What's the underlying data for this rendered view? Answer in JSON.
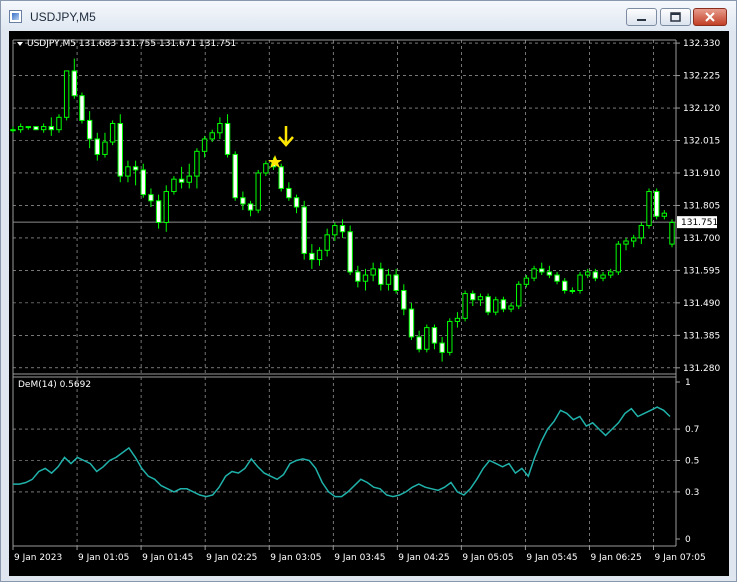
{
  "window": {
    "title": "USDJPY,M5"
  },
  "symbol_info": "USDJPY,M5  131.683 131.755 131.671 131.751",
  "current_price": "131.751",
  "indicator_label": "DeM(14) 0.5692",
  "colors": {
    "background": "#000000",
    "grid": "#c0c0c0",
    "bull": "#00ff00",
    "bear": "#ffffff",
    "indicator": "#20b2aa",
    "marker": "#ffe600"
  },
  "chart_data": {
    "type": "candlestick",
    "symbol": "USDJPY",
    "timeframe": "M5",
    "price_axis": [
      "132.330",
      "132.225",
      "132.120",
      "132.015",
      "131.910",
      "131.805",
      "131.700",
      "131.595",
      "131.490",
      "131.385",
      "131.280"
    ],
    "price_range": [
      131.26,
      132.34
    ],
    "time_axis": [
      "9 Jan 2023",
      "9 Jan 01:05",
      "9 Jan 01:45",
      "9 Jan 02:25",
      "9 Jan 03:05",
      "9 Jan 03:45",
      "9 Jan 04:25",
      "9 Jan 05:05",
      "9 Jan 05:45",
      "9 Jan 06:25",
      "9 Jan 07:05"
    ],
    "candles": [
      {
        "o": 132.05,
        "h": 132.06,
        "l": 132.04,
        "c": 132.05
      },
      {
        "o": 132.05,
        "h": 132.07,
        "l": 132.04,
        "c": 132.06
      },
      {
        "o": 132.06,
        "h": 132.06,
        "l": 132.05,
        "c": 132.06
      },
      {
        "o": 132.06,
        "h": 132.06,
        "l": 132.05,
        "c": 132.05
      },
      {
        "o": 132.05,
        "h": 132.07,
        "l": 132.04,
        "c": 132.06
      },
      {
        "o": 132.06,
        "h": 132.09,
        "l": 132.03,
        "c": 132.05
      },
      {
        "o": 132.05,
        "h": 132.1,
        "l": 132.04,
        "c": 132.09
      },
      {
        "o": 132.09,
        "h": 132.24,
        "l": 132.08,
        "c": 132.24
      },
      {
        "o": 132.24,
        "h": 132.28,
        "l": 132.15,
        "c": 132.16
      },
      {
        "o": 132.16,
        "h": 132.17,
        "l": 132.07,
        "c": 132.08
      },
      {
        "o": 132.08,
        "h": 132.11,
        "l": 131.99,
        "c": 132.02
      },
      {
        "o": 132.02,
        "h": 132.04,
        "l": 131.95,
        "c": 131.97
      },
      {
        "o": 131.97,
        "h": 132.04,
        "l": 131.96,
        "c": 132.01
      },
      {
        "o": 132.01,
        "h": 132.08,
        "l": 132.0,
        "c": 132.07
      },
      {
        "o": 132.07,
        "h": 132.1,
        "l": 131.88,
        "c": 131.9
      },
      {
        "o": 131.9,
        "h": 131.95,
        "l": 131.88,
        "c": 131.93
      },
      {
        "o": 131.93,
        "h": 131.95,
        "l": 131.87,
        "c": 131.92
      },
      {
        "o": 131.92,
        "h": 131.94,
        "l": 131.83,
        "c": 131.84
      },
      {
        "o": 131.84,
        "h": 131.86,
        "l": 131.8,
        "c": 131.82
      },
      {
        "o": 131.82,
        "h": 131.84,
        "l": 131.73,
        "c": 131.75
      },
      {
        "o": 131.75,
        "h": 131.87,
        "l": 131.72,
        "c": 131.85
      },
      {
        "o": 131.85,
        "h": 131.9,
        "l": 131.84,
        "c": 131.89
      },
      {
        "o": 131.89,
        "h": 131.93,
        "l": 131.86,
        "c": 131.88
      },
      {
        "o": 131.88,
        "h": 131.94,
        "l": 131.86,
        "c": 131.9
      },
      {
        "o": 131.9,
        "h": 131.99,
        "l": 131.86,
        "c": 131.98
      },
      {
        "o": 131.98,
        "h": 132.03,
        "l": 131.96,
        "c": 132.02
      },
      {
        "o": 132.02,
        "h": 132.05,
        "l": 132.01,
        "c": 132.04
      },
      {
        "o": 132.04,
        "h": 132.09,
        "l": 132.02,
        "c": 132.07
      },
      {
        "o": 132.07,
        "h": 132.1,
        "l": 131.96,
        "c": 131.97
      },
      {
        "o": 131.97,
        "h": 131.98,
        "l": 131.82,
        "c": 131.83
      },
      {
        "o": 131.83,
        "h": 131.85,
        "l": 131.79,
        "c": 131.81
      },
      {
        "o": 131.81,
        "h": 131.82,
        "l": 131.77,
        "c": 131.79
      },
      {
        "o": 131.79,
        "h": 131.92,
        "l": 131.78,
        "c": 131.91
      },
      {
        "o": 131.91,
        "h": 131.95,
        "l": 131.9,
        "c": 131.94
      },
      {
        "o": 131.94,
        "h": 131.96,
        "l": 131.92,
        "c": 131.93
      },
      {
        "o": 131.93,
        "h": 131.94,
        "l": 131.85,
        "c": 131.86
      },
      {
        "o": 131.86,
        "h": 131.88,
        "l": 131.82,
        "c": 131.83
      },
      {
        "o": 131.83,
        "h": 131.84,
        "l": 131.78,
        "c": 131.8
      },
      {
        "o": 131.8,
        "h": 131.82,
        "l": 131.63,
        "c": 131.65
      },
      {
        "o": 131.65,
        "h": 131.68,
        "l": 131.6,
        "c": 131.63
      },
      {
        "o": 131.63,
        "h": 131.67,
        "l": 131.61,
        "c": 131.66
      },
      {
        "o": 131.66,
        "h": 131.73,
        "l": 131.64,
        "c": 131.71
      },
      {
        "o": 131.71,
        "h": 131.75,
        "l": 131.69,
        "c": 131.74
      },
      {
        "o": 131.74,
        "h": 131.76,
        "l": 131.7,
        "c": 131.72
      },
      {
        "o": 131.72,
        "h": 131.74,
        "l": 131.58,
        "c": 131.59
      },
      {
        "o": 131.59,
        "h": 131.61,
        "l": 131.54,
        "c": 131.56
      },
      {
        "o": 131.56,
        "h": 131.6,
        "l": 131.53,
        "c": 131.58
      },
      {
        "o": 131.58,
        "h": 131.62,
        "l": 131.56,
        "c": 131.6
      },
      {
        "o": 131.6,
        "h": 131.62,
        "l": 131.53,
        "c": 131.55
      },
      {
        "o": 131.55,
        "h": 131.6,
        "l": 131.53,
        "c": 131.58
      },
      {
        "o": 131.58,
        "h": 131.6,
        "l": 131.52,
        "c": 131.53
      },
      {
        "o": 131.53,
        "h": 131.55,
        "l": 131.45,
        "c": 131.47
      },
      {
        "o": 131.47,
        "h": 131.49,
        "l": 131.37,
        "c": 131.38
      },
      {
        "o": 131.38,
        "h": 131.4,
        "l": 131.33,
        "c": 131.34
      },
      {
        "o": 131.34,
        "h": 131.42,
        "l": 131.33,
        "c": 131.41
      },
      {
        "o": 131.41,
        "h": 131.42,
        "l": 131.34,
        "c": 131.36
      },
      {
        "o": 131.36,
        "h": 131.38,
        "l": 131.3,
        "c": 131.33
      },
      {
        "o": 131.33,
        "h": 131.44,
        "l": 131.32,
        "c": 131.43
      },
      {
        "o": 131.43,
        "h": 131.46,
        "l": 131.41,
        "c": 131.44
      },
      {
        "o": 131.44,
        "h": 131.53,
        "l": 131.43,
        "c": 131.52
      },
      {
        "o": 131.52,
        "h": 131.53,
        "l": 131.48,
        "c": 131.5
      },
      {
        "o": 131.5,
        "h": 131.52,
        "l": 131.48,
        "c": 131.51
      },
      {
        "o": 131.51,
        "h": 131.52,
        "l": 131.45,
        "c": 131.46
      },
      {
        "o": 131.46,
        "h": 131.51,
        "l": 131.45,
        "c": 131.5
      },
      {
        "o": 131.5,
        "h": 131.51,
        "l": 131.46,
        "c": 131.47
      },
      {
        "o": 131.47,
        "h": 131.49,
        "l": 131.46,
        "c": 131.48
      },
      {
        "o": 131.48,
        "h": 131.56,
        "l": 131.47,
        "c": 131.55
      },
      {
        "o": 131.55,
        "h": 131.58,
        "l": 131.54,
        "c": 131.57
      },
      {
        "o": 131.57,
        "h": 131.61,
        "l": 131.56,
        "c": 131.6
      },
      {
        "o": 131.6,
        "h": 131.62,
        "l": 131.58,
        "c": 131.59
      },
      {
        "o": 131.59,
        "h": 131.61,
        "l": 131.57,
        "c": 131.58
      },
      {
        "o": 131.58,
        "h": 131.59,
        "l": 131.55,
        "c": 131.56
      },
      {
        "o": 131.56,
        "h": 131.57,
        "l": 131.52,
        "c": 131.53
      },
      {
        "o": 131.53,
        "h": 131.54,
        "l": 131.52,
        "c": 131.53
      },
      {
        "o": 131.53,
        "h": 131.59,
        "l": 131.52,
        "c": 131.58
      },
      {
        "o": 131.58,
        "h": 131.6,
        "l": 131.57,
        "c": 131.59
      },
      {
        "o": 131.59,
        "h": 131.6,
        "l": 131.56,
        "c": 131.57
      },
      {
        "o": 131.57,
        "h": 131.59,
        "l": 131.56,
        "c": 131.58
      },
      {
        "o": 131.58,
        "h": 131.6,
        "l": 131.57,
        "c": 131.59
      },
      {
        "o": 131.59,
        "h": 131.69,
        "l": 131.58,
        "c": 131.68
      },
      {
        "o": 131.68,
        "h": 131.7,
        "l": 131.66,
        "c": 131.69
      },
      {
        "o": 131.69,
        "h": 131.71,
        "l": 131.67,
        "c": 131.7
      },
      {
        "o": 131.7,
        "h": 131.75,
        "l": 131.68,
        "c": 131.74
      },
      {
        "o": 131.74,
        "h": 131.86,
        "l": 131.73,
        "c": 131.85
      },
      {
        "o": 131.85,
        "h": 131.86,
        "l": 131.76,
        "c": 131.77
      },
      {
        "o": 131.77,
        "h": 131.79,
        "l": 131.76,
        "c": 131.78
      },
      {
        "o": 131.68,
        "h": 131.76,
        "l": 131.67,
        "c": 131.75
      }
    ],
    "indicator": {
      "name": "DeM(14)",
      "value": 0.5692,
      "axis_labels": [
        "1",
        "0.7",
        "0.5",
        "0.3",
        "0"
      ],
      "range": [
        0,
        1
      ],
      "values": [
        0.35,
        0.35,
        0.36,
        0.38,
        0.43,
        0.45,
        0.42,
        0.46,
        0.52,
        0.48,
        0.52,
        0.5,
        0.48,
        0.43,
        0.46,
        0.5,
        0.52,
        0.55,
        0.58,
        0.52,
        0.45,
        0.4,
        0.38,
        0.34,
        0.32,
        0.3,
        0.32,
        0.32,
        0.3,
        0.28,
        0.27,
        0.28,
        0.33,
        0.4,
        0.43,
        0.42,
        0.45,
        0.51,
        0.46,
        0.42,
        0.4,
        0.38,
        0.41,
        0.48,
        0.5,
        0.51,
        0.5,
        0.45,
        0.36,
        0.3,
        0.27,
        0.27,
        0.3,
        0.34,
        0.38,
        0.36,
        0.33,
        0.32,
        0.28,
        0.27,
        0.28,
        0.3,
        0.33,
        0.35,
        0.33,
        0.32,
        0.31,
        0.33,
        0.36,
        0.3,
        0.28,
        0.32,
        0.38,
        0.45,
        0.5,
        0.48,
        0.46,
        0.48,
        0.42,
        0.45,
        0.4,
        0.52,
        0.62,
        0.7,
        0.75,
        0.82,
        0.8,
        0.76,
        0.78,
        0.72,
        0.74,
        0.7,
        0.66,
        0.7,
        0.74,
        0.8,
        0.83,
        0.78,
        0.8,
        0.82,
        0.84,
        0.82,
        0.78
      ]
    },
    "grid": true
  }
}
